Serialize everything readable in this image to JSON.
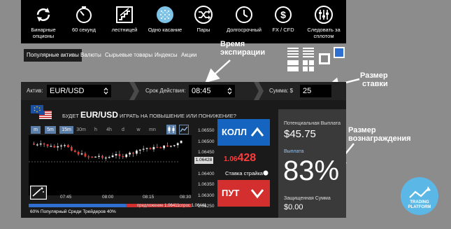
{
  "option_types": [
    {
      "label": "Бинарные опционы",
      "icon": "refresh-icon"
    },
    {
      "label": "60 секунд",
      "icon": "timer-icon"
    },
    {
      "label": "лестницей",
      "icon": "ladder-icon"
    },
    {
      "label": "Одно касание",
      "icon": "one-touch-icon"
    },
    {
      "label": "Пары",
      "icon": "shuffle-icon"
    },
    {
      "label": "Долгосрочный",
      "icon": "clock-icon"
    },
    {
      "label": "FX / CFD",
      "icon": "dollar-icon"
    },
    {
      "label": "Следовать за сплотом",
      "icon": "sliders-icon"
    }
  ],
  "categories": [
    "Популярные активы",
    "Валюты",
    "Сырьевые товары",
    "Индексы",
    "Акции"
  ],
  "callouts": {
    "expiry_line1": "Время",
    "expiry_line2": "экспирации",
    "stake_line1": "Размер",
    "stake_line2": "ставки",
    "reward_line1": "Размер",
    "reward_line2": "вознаграждения"
  },
  "settings": {
    "asset_label": "Актив:",
    "asset_value": "EUR/USD",
    "expiry_label": "Срок Действия:",
    "expiry_value": "08:45",
    "amount_label": "Сумма: $",
    "amount_value": "25"
  },
  "question": {
    "prefix": "БУДЕТ",
    "asset": "EUR/USD",
    "suffix": "ИГРАТЬ НА ПОВЫШЕНИЕ ИЛИ ПОНИЖЕНИЕ?"
  },
  "timeframes": [
    "m",
    "5m",
    "15m",
    "30m",
    "h",
    "4h",
    "d",
    "w",
    "mn"
  ],
  "active_timeframes": [
    "m",
    "5m",
    "15m"
  ],
  "chart": {
    "price_ticks": [
      "1.06550",
      "1.06500",
      "1.06450",
      "1.06400",
      "1.06350",
      "1.06300",
      "1.06250"
    ],
    "current_price_tag": "1.06428",
    "time_ticks": [
      "07:45",
      "08:00",
      "08:15",
      "08:30"
    ]
  },
  "trade": {
    "call_label": "КОЛЛ",
    "put_label": "ПУТ",
    "strike_prefix": "1.06",
    "strike_suffix": "428",
    "strike_label": "Ставка страйка"
  },
  "payout": {
    "potential_label": "Потенциальная Выплата",
    "potential_value": "$45.75",
    "payout_label": "Выплата",
    "payout_value": "83%",
    "protected_label": "Защищенная Сумма",
    "protected_value": "$0.00"
  },
  "sentiment": {
    "text": "60% Популярный Среди Трейдеров 40%",
    "call_share": 0.6
  },
  "quotes": {
    "bid_label": "предложение",
    "bid_value": "1.06411",
    "ask_label": "спрос",
    "ask_value": "1.06441"
  },
  "badge": {
    "line1": "TRADING",
    "line2": "PLATFORM"
  },
  "colors": {
    "call": "#1565c0",
    "put": "#d32f2f",
    "accent": "#2f6fd0",
    "strike_red": "#ff3b3b"
  }
}
